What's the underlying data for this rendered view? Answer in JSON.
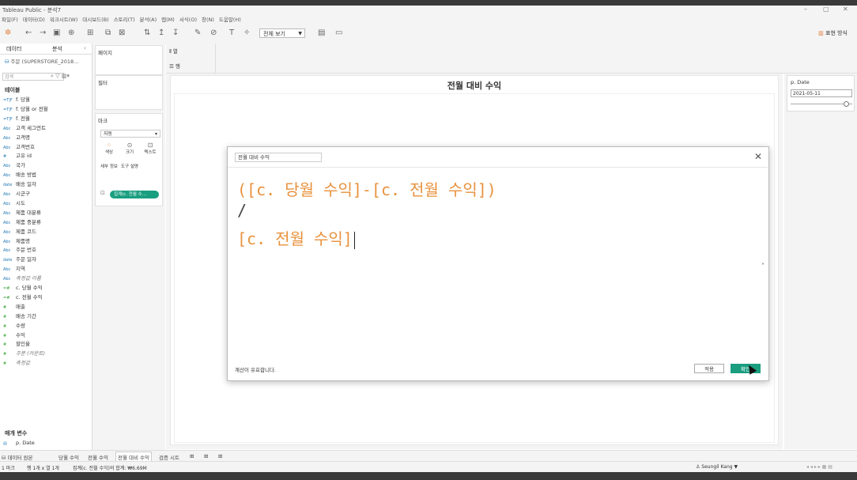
{
  "window": {
    "title": "Tableau Public - 분석7"
  },
  "menu": [
    "파일(F)",
    "데이터(D)",
    "워크시트(W)",
    "대시보드(B)",
    "스토리(T)",
    "분석(A)",
    "맵(M)",
    "서식(O)",
    "창(N)",
    "도움말(H)"
  ],
  "toolbar": {
    "view_select": "전체 보기",
    "show_me": "표현 방식"
  },
  "left": {
    "tab_data": "데이터",
    "tab_analysis": "분석",
    "datasource": "주문 (SUPERSTORE_2018...",
    "search_placeholder": "검색",
    "tables_title": "테이블",
    "fields": [
      {
        "type": "=T|F",
        "label": "f. 당월"
      },
      {
        "type": "=T|F",
        "label": "f. 당월 or 전월"
      },
      {
        "type": "=T|F",
        "label": "f. 전월"
      },
      {
        "type": "Abc",
        "label": "고객 세그먼트"
      },
      {
        "type": "Abc",
        "label": "고객명"
      },
      {
        "type": "Abc",
        "label": "고객번호"
      },
      {
        "type": "#",
        "label": "고유 id"
      },
      {
        "type": "Abc",
        "label": "국가"
      },
      {
        "type": "Abc",
        "label": "배송 방법"
      },
      {
        "type": "date",
        "label": "배송 일자"
      },
      {
        "type": "Abc",
        "label": "시군구"
      },
      {
        "type": "Abc",
        "label": "시도"
      },
      {
        "type": "Abc",
        "label": "제품 대분류"
      },
      {
        "type": "Abc",
        "label": "제품 중분류"
      },
      {
        "type": "Abc",
        "label": "제품 코드"
      },
      {
        "type": "Abc",
        "label": "제품명"
      },
      {
        "type": "Abc",
        "label": "주문 번호"
      },
      {
        "type": "date",
        "label": "주문 일자"
      },
      {
        "type": "Abc",
        "label": "지역"
      },
      {
        "type": "Abc",
        "label": "측정값 이름",
        "italic": true
      },
      {
        "type": "=#",
        "label": "c. 당월 수익",
        "measure": true
      },
      {
        "type": "=#",
        "label": "c. 전월 수익",
        "measure": true
      },
      {
        "type": "#",
        "label": "매출",
        "measure": true
      },
      {
        "type": "#",
        "label": "배송 기간",
        "measure": true
      },
      {
        "type": "#",
        "label": "수량",
        "measure": true
      },
      {
        "type": "#",
        "label": "수익",
        "measure": true
      },
      {
        "type": "#",
        "label": "할인율",
        "measure": true
      },
      {
        "type": "#",
        "label": "주문 (카운트)",
        "measure": true,
        "italic": true
      },
      {
        "type": "#",
        "label": "측정값",
        "measure": true,
        "italic": true
      }
    ],
    "params_title": "매개 변수",
    "param_field": "p. Date"
  },
  "shelves": {
    "pages": "페이지",
    "filters": "필터",
    "marks": "마크",
    "mark_type": "자동",
    "mark_buttons": [
      "색상",
      "크기",
      "텍스트",
      "세부 정보",
      "도구 설명"
    ],
    "pill": "집계(c. 전월 수..."
  },
  "columns_label": "열",
  "rows_label": "행",
  "sheet_title": "전월 대비 수익",
  "parameter": {
    "title": "p. Date",
    "value": "2021-05-11"
  },
  "dialog": {
    "name": "전월 대비 수익",
    "formula_line1": "([c. 당월 수익]-[c. 전월 수익])",
    "formula_line2": "/",
    "formula_line3": "[c. 전월 수익]",
    "status": "계산이 유효합니다.",
    "apply": "적용",
    "ok": "확인"
  },
  "sheet_tabs": [
    "데이터 원본",
    "당월 수익",
    "전월 수익",
    "전월 대비 수익",
    "검증 시트"
  ],
  "active_tab": "전월 대비 수익",
  "status": {
    "marks": "1 마크",
    "rowcol": "행 1개 x 열 1개",
    "sum": "집계(c. 전월 수익)의 합계: ₩6.69M",
    "user": "Seungil Kang"
  }
}
